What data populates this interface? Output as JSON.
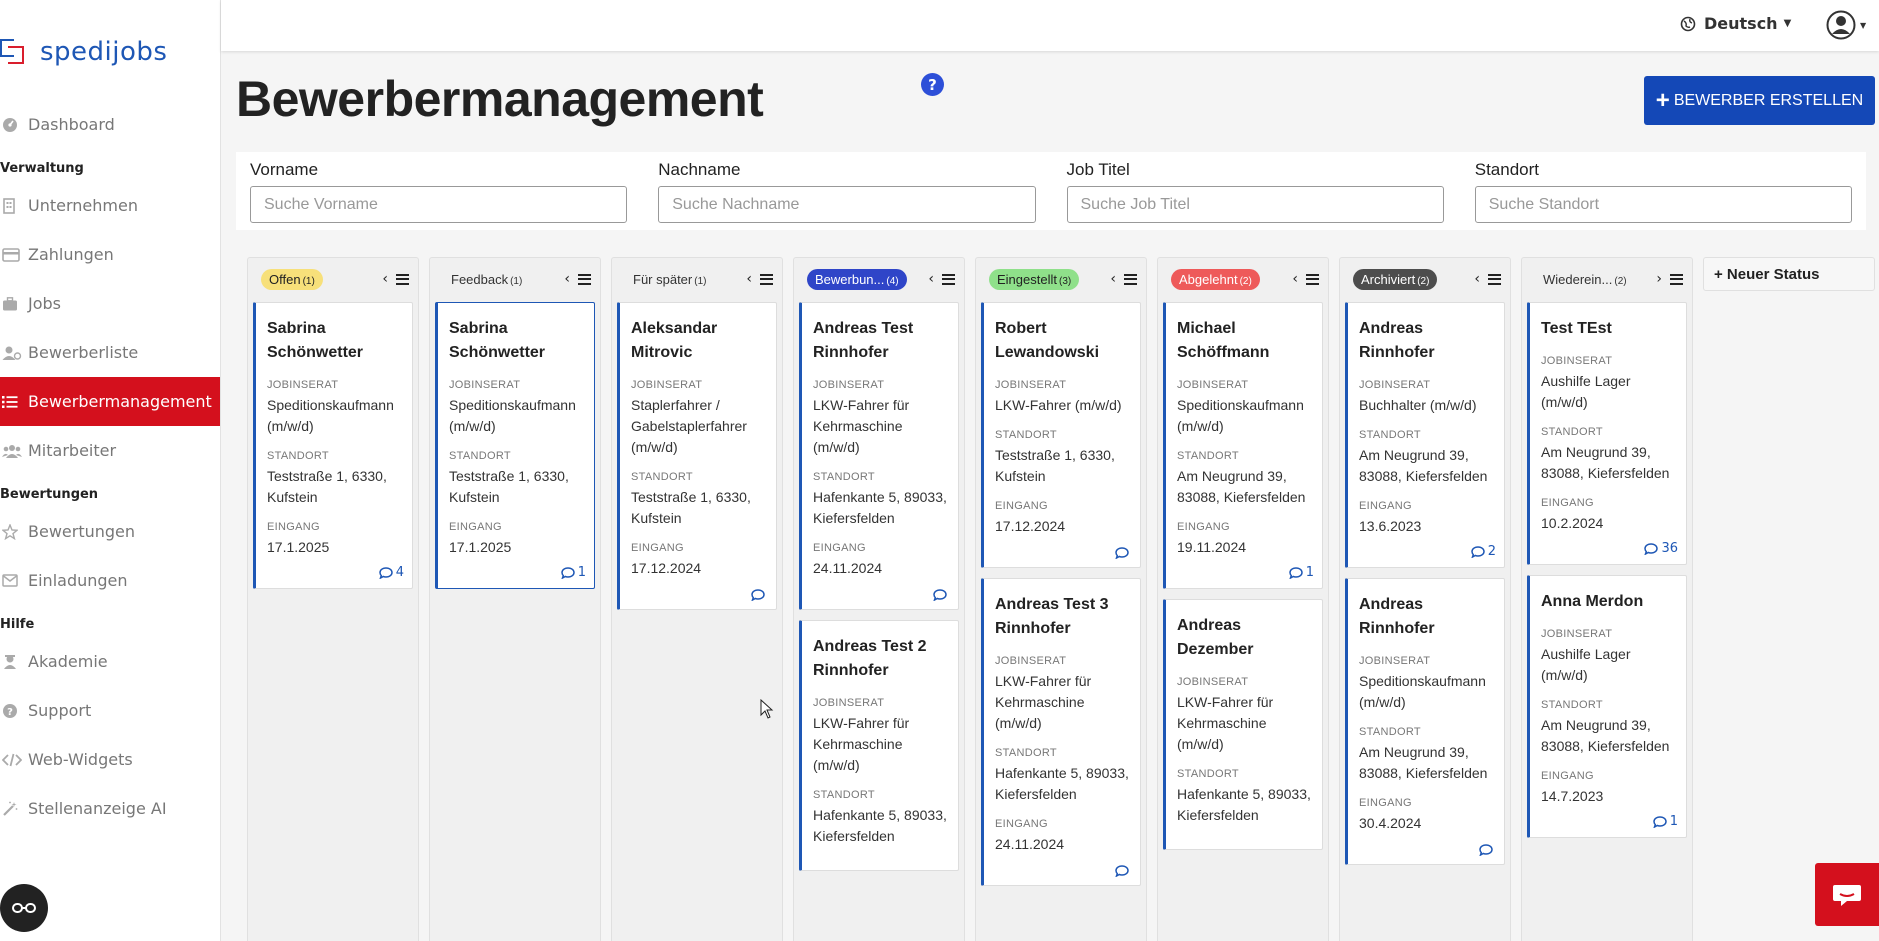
{
  "brand": {
    "name": "spedijobs",
    "colors": {
      "blue": "#1e57b5",
      "red": "#d91e2d"
    }
  },
  "sidebar": {
    "items": [
      {
        "type": "item",
        "label": "Dashboard",
        "icon": "dashboard-icon"
      },
      {
        "type": "section",
        "label": "Verwaltung"
      },
      {
        "type": "item",
        "label": "Unternehmen",
        "icon": "building-icon"
      },
      {
        "type": "item",
        "label": "Zahlungen",
        "icon": "credit-card-icon"
      },
      {
        "type": "item",
        "label": "Jobs",
        "icon": "briefcase-icon"
      },
      {
        "type": "item",
        "label": "Bewerberliste",
        "icon": "user-list-icon"
      },
      {
        "type": "item",
        "label": "Bewerbermanagement",
        "icon": "list-icon",
        "active": true
      },
      {
        "type": "item",
        "label": "Mitarbeiter",
        "icon": "users-icon"
      },
      {
        "type": "section",
        "label": "Bewertungen"
      },
      {
        "type": "item",
        "label": "Bewertungen",
        "icon": "star-icon"
      },
      {
        "type": "item",
        "label": "Einladungen",
        "icon": "envelope-icon"
      },
      {
        "type": "section",
        "label": "Hilfe"
      },
      {
        "type": "item",
        "label": "Akademie",
        "icon": "graduation-icon"
      },
      {
        "type": "item",
        "label": "Support",
        "icon": "question-icon"
      },
      {
        "type": "item",
        "label": "Web-Widgets",
        "icon": "code-icon"
      },
      {
        "type": "item",
        "label": "Stellenanzeige AI",
        "icon": "magic-wand-icon"
      }
    ]
  },
  "topbar": {
    "language": "Deutsch"
  },
  "page": {
    "title": "Bewerbermanagement",
    "help": "?",
    "create_button": "BEWERBER ERSTELLEN"
  },
  "filters": [
    {
      "label": "Vorname",
      "placeholder": "Suche Vorname",
      "value": ""
    },
    {
      "label": "Nachname",
      "placeholder": "Suche Nachname",
      "value": ""
    },
    {
      "label": "Job Titel",
      "placeholder": "Suche Job Titel",
      "value": ""
    },
    {
      "label": "Standort",
      "placeholder": "Suche Standort",
      "value": ""
    }
  ],
  "card_labels": {
    "job": "JOBINSERAT",
    "location": "STANDORT",
    "received": "EINGANG"
  },
  "columns": [
    {
      "name": "Offen",
      "count": "(1)",
      "bg": "#f7e07a",
      "fg": "#222",
      "arrow": "‹",
      "cards": [
        {
          "name": "Sabrina Schönwetter",
          "job": "Speditionskaufmann (m/w/d)",
          "location": "Teststraße 1, 6330, Kufstein",
          "received": "17.1.2025",
          "comments": "4"
        }
      ]
    },
    {
      "name": "Feedback",
      "count": "(1)",
      "bg": "transparent",
      "fg": "#333",
      "arrow": "‹",
      "cards": [
        {
          "name": "Sabrina Schönwetter",
          "job": "Speditionskaufmann (m/w/d)",
          "location": "Teststraße 1, 6330, Kufstein",
          "received": "17.1.2025",
          "comments": "1",
          "selected": true
        }
      ]
    },
    {
      "name": "Für später",
      "count": "(1)",
      "bg": "transparent",
      "fg": "#333",
      "arrow": "‹",
      "cards": [
        {
          "name": "Aleksandar Mitrovic",
          "job": "Staplerfahrer / Gabelstaplerfahrer (m/w/d)",
          "location": "Teststraße 1, 6330, Kufstein",
          "received": "17.12.2024",
          "comments": ""
        }
      ]
    },
    {
      "name": "Bewerbun...",
      "count": "(4)",
      "bg": "#2f45c8",
      "fg": "#fff",
      "arrow": "‹",
      "cards": [
        {
          "name": "Andreas Test Rinnhofer",
          "job": "LKW-Fahrer für Kehrmaschine (m/w/d)",
          "location": "Hafenkante 5, 89033, Kiefersfelden",
          "received": "24.11.2024",
          "comments": ""
        },
        {
          "name": "Andreas Test 2 Rinnhofer",
          "job": "LKW-Fahrer für Kehrmaschine (m/w/d)",
          "location": "Hafenkante 5, 89033, Kiefersfelden",
          "received": "",
          "comments": ""
        }
      ]
    },
    {
      "name": "Eingestellt",
      "count": "(3)",
      "bg": "#8fe08a",
      "fg": "#222",
      "arrow": "‹",
      "cards": [
        {
          "name": "Robert Lewandowski",
          "job": "LKW-Fahrer (m/w/d)",
          "location": "Teststraße 1, 6330, Kufstein",
          "received": "17.12.2024",
          "comments": ""
        },
        {
          "name": "Andreas Test 3 Rinnhofer",
          "job": "LKW-Fahrer für Kehrmaschine (m/w/d)",
          "location": "Hafenkante 5, 89033, Kiefersfelden",
          "received": "24.11.2024",
          "comments": ""
        }
      ]
    },
    {
      "name": "Abgelehnt",
      "count": "(2)",
      "bg": "#ee5a5a",
      "fg": "#fff",
      "arrow": "‹",
      "cards": [
        {
          "name": "Michael Schöffmann",
          "job": "Speditionskaufmann (m/w/d)",
          "location": "Am Neugrund 39, 83088, Kiefersfelden",
          "received": "19.11.2024",
          "comments": "1"
        },
        {
          "name": "Andreas Dezember",
          "job": "LKW-Fahrer für Kehrmaschine (m/w/d)",
          "location": "Hafenkante 5, 89033, Kiefersfelden",
          "received": "",
          "comments": ""
        }
      ]
    },
    {
      "name": "Archiviert",
      "count": "(2)",
      "bg": "#4d4d4d",
      "fg": "#fff",
      "arrow": "‹",
      "cards": [
        {
          "name": "Andreas Rinnhofer",
          "job": "Buchhalter (m/w/d)",
          "location": "Am Neugrund 39, 83088, Kiefersfelden",
          "received": "13.6.2023",
          "comments": "2"
        },
        {
          "name": "Andreas Rinnhofer",
          "job": "Speditionskaufmann (m/w/d)",
          "location": "Am Neugrund 39, 83088, Kiefersfelden",
          "received": "30.4.2024",
          "comments": ""
        }
      ]
    },
    {
      "name": "Wiederein...",
      "count": "(2)",
      "bg": "transparent",
      "fg": "#333",
      "arrow": "›",
      "cards": [
        {
          "name": "Test TEst",
          "job": "Aushilfe Lager (m/w/d)",
          "location": "Am Neugrund 39, 83088, Kiefersfelden",
          "received": "10.2.2024",
          "comments": "36"
        },
        {
          "name": "Anna Merdon",
          "job": "Aushilfe Lager (m/w/d)",
          "location": "Am Neugrund 39, 83088, Kiefersfelden",
          "received": "14.7.2023",
          "comments": "1"
        }
      ]
    }
  ],
  "new_status": "+ Neuer Status"
}
